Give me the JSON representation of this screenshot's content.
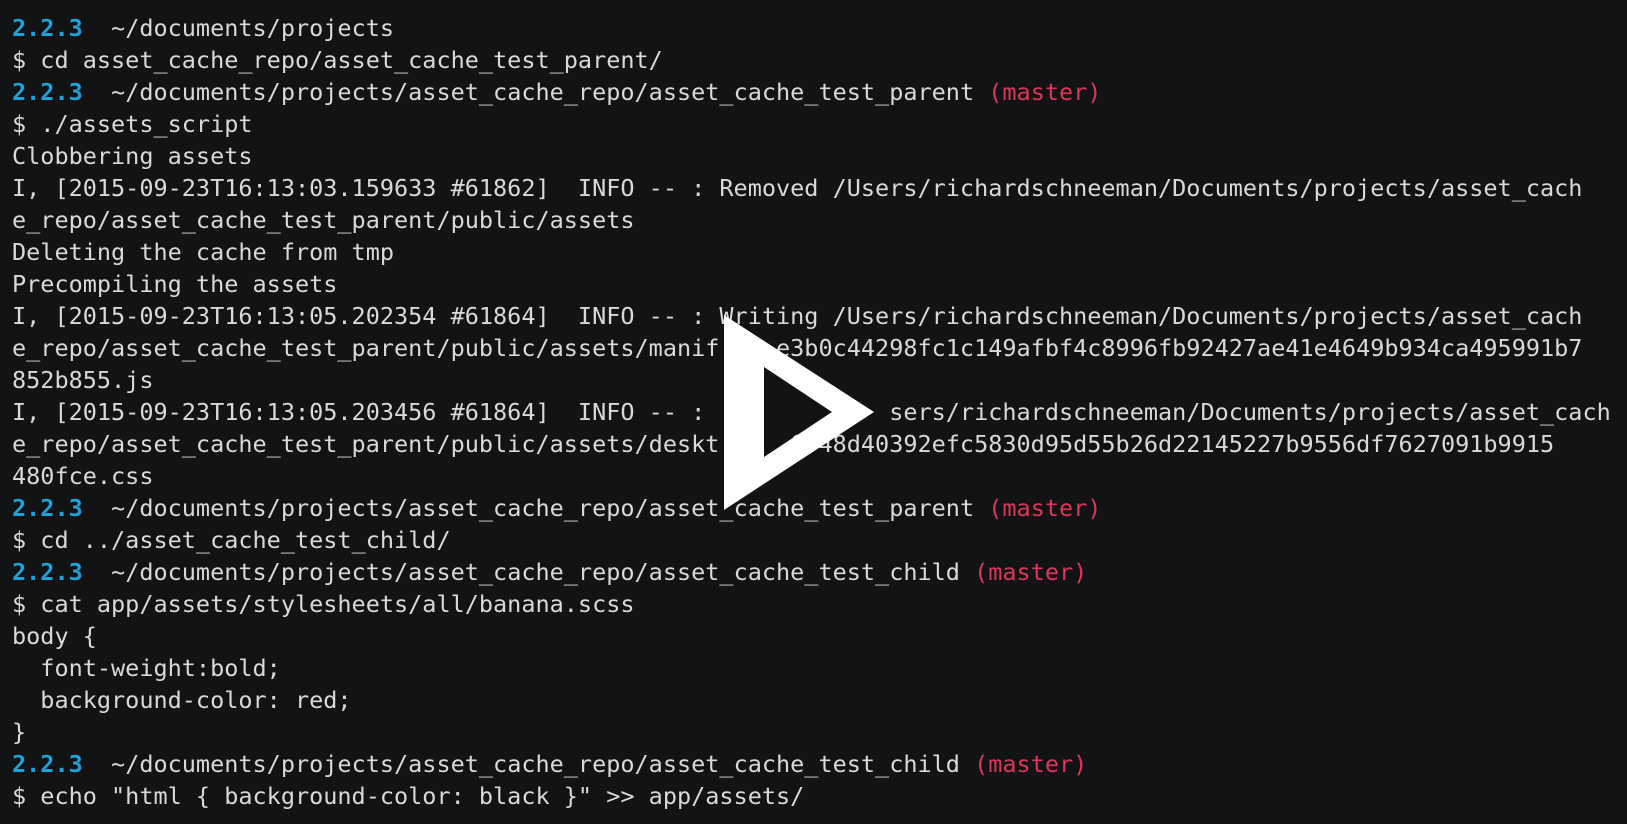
{
  "terminal": {
    "background_color": "#121314",
    "text_color": "#d9d9d9",
    "version_color": "#1ca3d8",
    "branch_color": "#e0345a",
    "lines": [
      {
        "type": "prompt",
        "version": "2.2.3",
        "path": "~/documents/projects",
        "branch": ""
      },
      {
        "type": "text",
        "text": "$ cd asset_cache_repo/asset_cache_test_parent/"
      },
      {
        "type": "prompt",
        "version": "2.2.3",
        "path": "~/documents/projects/asset_cache_repo/asset_cache_test_parent",
        "branch": "(master)"
      },
      {
        "type": "text",
        "text": "$ ./assets_script"
      },
      {
        "type": "text",
        "text": "Clobbering assets"
      },
      {
        "type": "text",
        "text": "I, [2015-09-23T16:13:03.159633 #61862]  INFO -- : Removed /Users/richardschneeman/Documents/projects/asset_cach"
      },
      {
        "type": "text",
        "text": "e_repo/asset_cache_test_parent/public/assets"
      },
      {
        "type": "text",
        "text": "Deleting the cache from tmp"
      },
      {
        "type": "text",
        "text": "Precompiling the assets"
      },
      {
        "type": "text",
        "text": "I, [2015-09-23T16:13:05.202354 #61864]  INFO -- : Writing /Users/richardschneeman/Documents/projects/asset_cach"
      },
      {
        "type": "text",
        "text": "e_repo/asset_cache_test_parent/public/assets/manif    e3b0c44298fc1c149afbf4c8996fb92427ae41e4649b934ca495991b7"
      },
      {
        "type": "text",
        "text": "852b855.js"
      },
      {
        "type": "text",
        "text": "I, [2015-09-23T16:13:05.203456 #61864]  INFO -- :             sers/richardschneeman/Documents/projects/asset_cach"
      },
      {
        "type": "text",
        "text": "e_repo/asset_cache_test_parent/public/assets/deskt     6948d40392efc5830d95d55b26d22145227b9556df7627091b9915"
      },
      {
        "type": "text",
        "text": "480fce.css"
      },
      {
        "type": "prompt",
        "version": "2.2.3",
        "path": "~/documents/projects/asset_cache_repo/asset_cache_test_parent",
        "branch": "(master)"
      },
      {
        "type": "text",
        "text": "$ cd ../asset_cache_test_child/"
      },
      {
        "type": "prompt",
        "version": "2.2.3",
        "path": "~/documents/projects/asset_cache_repo/asset_cache_test_child",
        "branch": "(master)"
      },
      {
        "type": "text",
        "text": "$ cat app/assets/stylesheets/all/banana.scss"
      },
      {
        "type": "text",
        "text": "body {"
      },
      {
        "type": "text",
        "text": "  font-weight:bold;"
      },
      {
        "type": "text",
        "text": "  background-color: red;"
      },
      {
        "type": "text",
        "text": "}"
      },
      {
        "type": "prompt",
        "version": "2.2.3",
        "path": "~/documents/projects/asset_cache_repo/asset_cache_test_child",
        "branch": "(master)"
      },
      {
        "type": "text",
        "text": "$ echo \"html { background-color: black }\" >> app/assets/"
      }
    ]
  },
  "overlay": {
    "icon": "play-icon",
    "color": "#ffffff"
  }
}
